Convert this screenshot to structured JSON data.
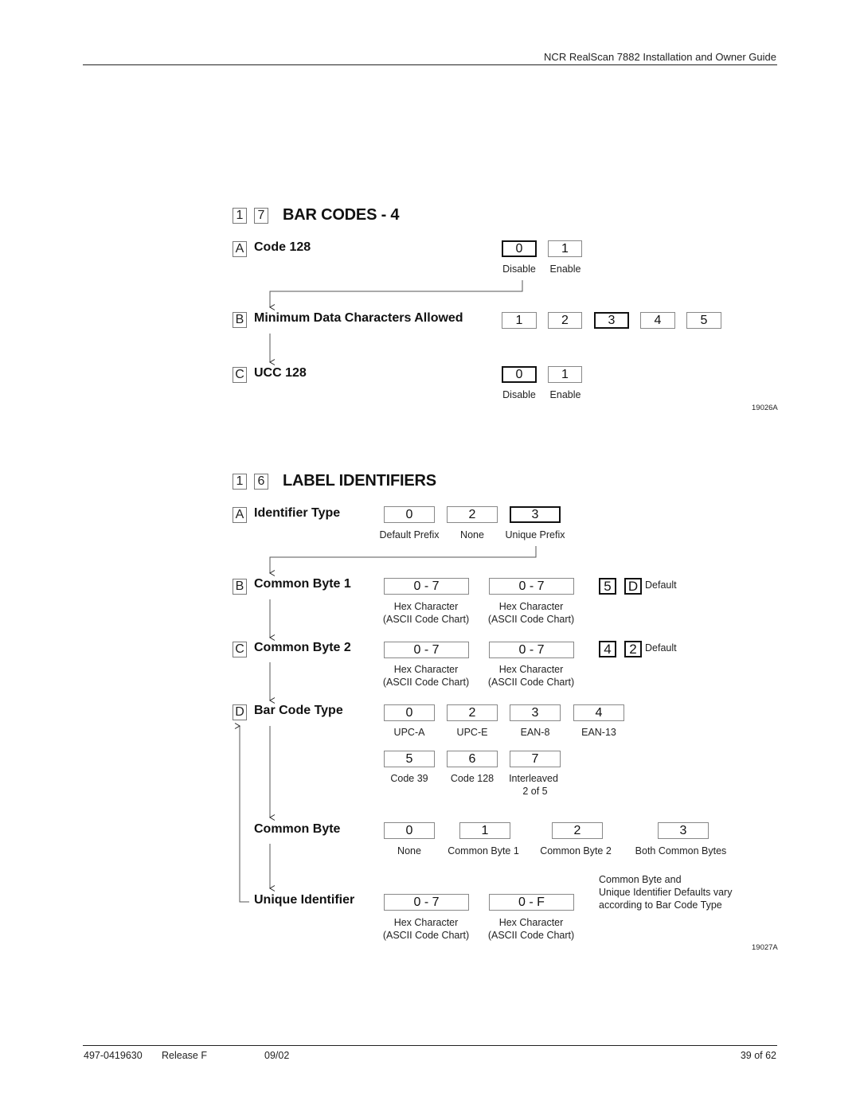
{
  "header": {
    "doc_title": "NCR RealScan 7882 Installation and Owner Guide"
  },
  "section_bar_codes": {
    "number_digits": [
      "1",
      "7"
    ],
    "title": "BAR CODES - 4",
    "figure_id": "19026A",
    "items": [
      {
        "letter": "A",
        "label": "Code 128",
        "options": [
          {
            "value": "0",
            "caption": "Disable",
            "selected": true
          },
          {
            "value": "1",
            "caption": "Enable",
            "selected": false
          }
        ]
      },
      {
        "letter": "B",
        "label": "Minimum Data Characters Allowed",
        "options": [
          {
            "value": "1",
            "selected": false
          },
          {
            "value": "2",
            "selected": false
          },
          {
            "value": "3",
            "selected": true
          },
          {
            "value": "4",
            "selected": false
          },
          {
            "value": "5",
            "selected": false
          }
        ]
      },
      {
        "letter": "C",
        "label": "UCC 128",
        "options": [
          {
            "value": "0",
            "caption": "Disable",
            "selected": true
          },
          {
            "value": "1",
            "caption": "Enable",
            "selected": false
          }
        ]
      }
    ]
  },
  "section_label_identifiers": {
    "number_digits": [
      "1",
      "6"
    ],
    "title": "LABEL IDENTIFIERS",
    "figure_id": "19027A",
    "identifier_type": {
      "letter": "A",
      "label": "Identifier Type",
      "options": [
        {
          "value": "0",
          "caption": "Default Prefix",
          "selected": false
        },
        {
          "value": "2",
          "caption": "None",
          "selected": false
        },
        {
          "value": "3",
          "caption": "Unique Prefix",
          "selected": true
        }
      ]
    },
    "common_byte_1": {
      "letter": "B",
      "label": "Common Byte 1",
      "fields": [
        {
          "range": "0 - 7",
          "caption_line1": "Hex Character",
          "caption_line2": "(ASCII Code Chart)"
        },
        {
          "range": "0 - 7",
          "caption_line1": "Hex Character",
          "caption_line2": "(ASCII Code Chart)"
        }
      ],
      "default_values": [
        "5",
        "D"
      ],
      "default_label": "Default"
    },
    "common_byte_2": {
      "letter": "C",
      "label": "Common Byte 2",
      "fields": [
        {
          "range": "0 - 7",
          "caption_line1": "Hex Character",
          "caption_line2": "(ASCII Code Chart)"
        },
        {
          "range": "0 - 7",
          "caption_line1": "Hex Character",
          "caption_line2": "(ASCII Code Chart)"
        }
      ],
      "default_values": [
        "4",
        "2"
      ],
      "default_label": "Default"
    },
    "bar_code_type": {
      "letter": "D",
      "label": "Bar Code Type",
      "options": [
        {
          "value": "0",
          "caption": "UPC-A"
        },
        {
          "value": "2",
          "caption": "UPC-E"
        },
        {
          "value": "3",
          "caption": "EAN-8"
        },
        {
          "value": "4",
          "caption": "EAN-13"
        },
        {
          "value": "5",
          "caption": "Code 39"
        },
        {
          "value": "6",
          "caption": "Code 128"
        },
        {
          "value": "7",
          "caption": "Interleaved",
          "caption_line2": "2 of 5"
        }
      ]
    },
    "common_byte": {
      "label": "Common Byte",
      "options": [
        {
          "value": "0",
          "caption": "None"
        },
        {
          "value": "1",
          "caption": "Common Byte 1"
        },
        {
          "value": "2",
          "caption": "Common Byte 2"
        },
        {
          "value": "3",
          "caption": "Both Common Bytes"
        }
      ]
    },
    "unique_identifier": {
      "label": "Unique Identifier",
      "fields": [
        {
          "range": "0 - 7",
          "caption_line1": "Hex Character",
          "caption_line2": "(ASCII Code Chart)"
        },
        {
          "range": "0 - F",
          "caption_line1": "Hex Character",
          "caption_line2": "(ASCII Code Chart)"
        }
      ]
    },
    "note": {
      "line1": "Common Byte and",
      "line2": "Unique Identifier Defaults vary",
      "line3": "according to Bar Code Type"
    }
  },
  "footer": {
    "doc_number": "497-0419630",
    "release": "Release F",
    "date": "09/02",
    "page": "39 of 62"
  }
}
